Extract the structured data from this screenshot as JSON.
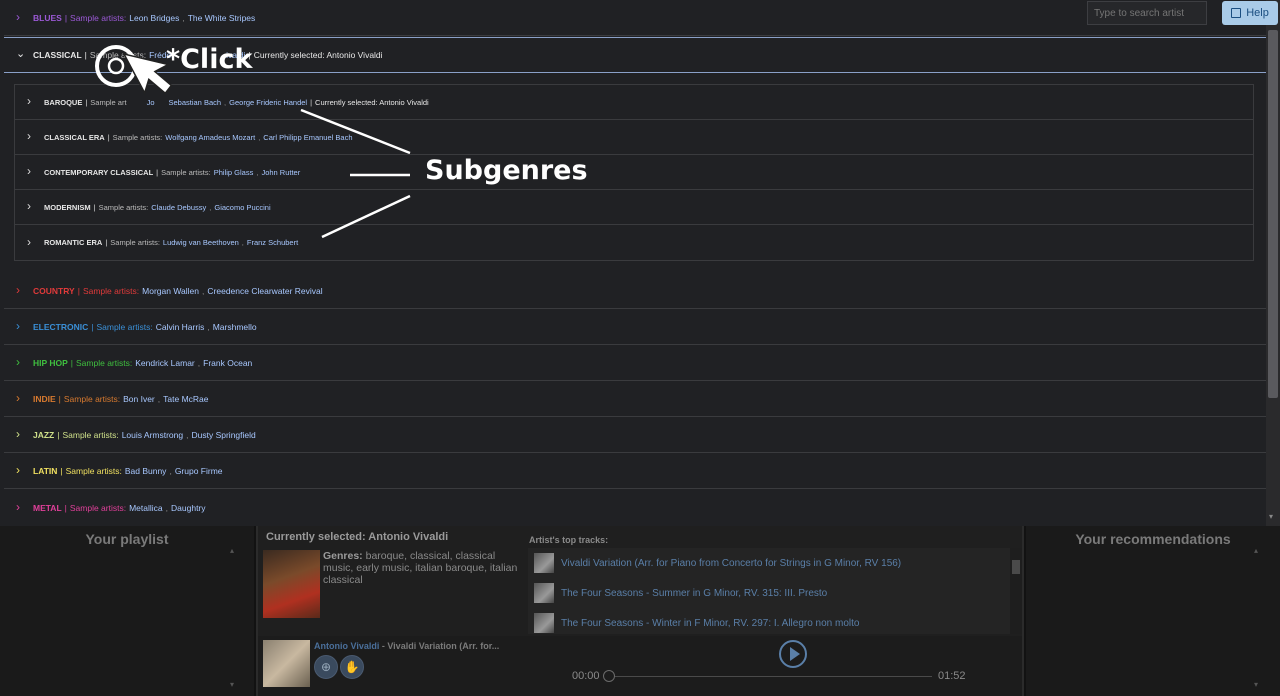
{
  "search": {
    "placeholder": "Type to search artist"
  },
  "help": {
    "label": "Help"
  },
  "genres": {
    "blues": {
      "name": "BLUES",
      "sample_label": "Sample artists:",
      "artists": [
        "Leon Bridges",
        "The White Stripes"
      ]
    },
    "classical": {
      "name": "CLASSICAL",
      "sample_label": "Sample artists:",
      "artist_fragment_1": "Frédér",
      "artist_fragment_2": "ivaldi",
      "selected": "Currently selected: Antonio Vivaldi"
    },
    "country": {
      "name": "COUNTRY",
      "sample_label": "Sample artists:",
      "artists": [
        "Morgan Wallen",
        "Creedence Clearwater Revival"
      ]
    },
    "electronic": {
      "name": "ELECTRONIC",
      "sample_label": "Sample artists:",
      "artists": [
        "Calvin Harris",
        "Marshmello"
      ]
    },
    "hiphop": {
      "name": "HIP HOP",
      "sample_label": "Sample artists:",
      "artists": [
        "Kendrick Lamar",
        "Frank Ocean"
      ]
    },
    "indie": {
      "name": "INDIE",
      "sample_label": "Sample artists:",
      "artists": [
        "Bon Iver",
        "Tate McRae"
      ]
    },
    "jazz": {
      "name": "JAZZ",
      "sample_label": "Sample artists:",
      "artists": [
        "Louis Armstrong",
        "Dusty Springfield"
      ]
    },
    "latin": {
      "name": "LATIN",
      "sample_label": "Sample artists:",
      "artists": [
        "Bad Bunny",
        "Grupo Firme"
      ]
    },
    "metal": {
      "name": "METAL",
      "sample_label": "Sample artists:",
      "artists": [
        "Metallica",
        "Daughtry"
      ]
    }
  },
  "subgenres": {
    "baroque": {
      "name": "BAROQUE",
      "sample_label": "Sample art",
      "artists": [
        "Jo",
        "Sebastian Bach",
        "George Frideric Handel"
      ],
      "selected": "Currently selected: Antonio Vivaldi"
    },
    "classical_era": {
      "name": "CLASSICAL ERA",
      "sample_label": "Sample artists:",
      "artists": [
        "Wolfgang Amadeus Mozart",
        "Carl Philipp Emanuel Bach"
      ]
    },
    "contemporary": {
      "name": "CONTEMPORARY CLASSICAL",
      "sample_label": "Sample artists:",
      "artists": [
        "Philip Glass",
        "John Rutter"
      ]
    },
    "modernism": {
      "name": "MODERNISM",
      "sample_label": "Sample artists:",
      "artists": [
        "Claude Debussy",
        "Giacomo Puccini"
      ]
    },
    "romantic": {
      "name": "ROMANTIC ERA",
      "sample_label": "Sample artists:",
      "artists": [
        "Ludwig van Beethoven",
        "Franz Schubert"
      ]
    }
  },
  "annotations": {
    "click": "*Click",
    "subgenres": "Subgenres"
  },
  "player": {
    "playlist_title": "Your playlist",
    "recommendations_title": "Your recommendations",
    "current_title": "Currently selected: Antonio Vivaldi",
    "genres_label": "Genres:",
    "genres_text": "baroque, classical, classical music, early music, italian baroque, italian classical",
    "top_tracks_title": "Artist's top tracks:",
    "tracks": [
      "Vivaldi Variation (Arr. for Piano from Concerto for Strings in G Minor, RV 156)",
      "The Four Seasons - Summer in G Minor, RV. 315: III. Presto",
      "The Four Seasons - Winter in F Minor, RV. 297: I. Allegro non molto"
    ],
    "now_playing_artist": "Antonio Vivaldi",
    "now_playing_title": " - Vivaldi Variation (Arr. for...",
    "time_current": "00:00",
    "time_total": "01:52",
    "progress": 0
  }
}
